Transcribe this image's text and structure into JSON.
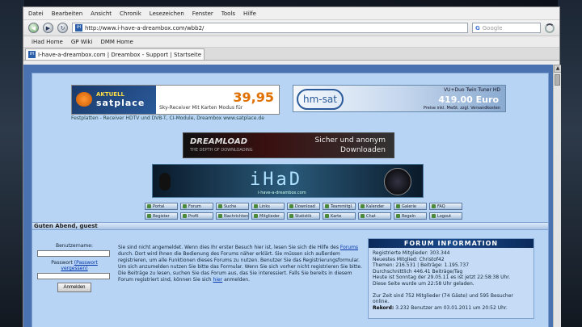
{
  "browser": {
    "menu": [
      "Datei",
      "Bearbeiten",
      "Ansicht",
      "Chronik",
      "Lesezeichen",
      "Fenster",
      "Tools",
      "Hilfe"
    ],
    "url": "http://www.i-have-a-dreambox.com/wbb2/",
    "search_placeholder": "Google",
    "bookmarks": [
      "iHad Home",
      "GP Wiki",
      "DMM Home"
    ],
    "tab_title": "I-have-a-dreambox.com | Dreambox - Support | Startseite"
  },
  "banners": {
    "satplace": {
      "aktuell": "AKTUELL",
      "name": "satplace",
      "price": "39,95",
      "slogan": "Sky-Receiver Mit Karten Modus für",
      "footer": "Festplatten - Receiver HDTV und DVB-T, CI-Module, Dreambox www.satplace.de"
    },
    "hmsat": {
      "logo": "hm-sat",
      "product": "VU+Duo Twin Tuner HD",
      "price": "419.00 Euro",
      "sub": "Preise inkl. MwSt. zzgl. Versandkosten"
    },
    "dreamload": {
      "logo": "DREAMLOAD",
      "sub": "THE DEPTH OF DOWNLOADING",
      "line1": "Sicher und anonym",
      "line2": "Downloaden"
    },
    "ihad": {
      "title": "iHaD",
      "url": "i-have-a-dreambox.com"
    }
  },
  "nav_icons": {
    "row1": [
      "Portal",
      "Forum",
      "Suche",
      "Links",
      "Download",
      "Teammitgl.",
      "Kalender",
      "Galerie",
      "FAQ"
    ],
    "row2": [
      "Register",
      "Profil",
      "Nachrichten",
      "Mitglieder",
      "Statistik",
      "Karte",
      "Chat",
      "Regeln",
      "Logout"
    ]
  },
  "greeting": "Guten Abend, guest",
  "login": {
    "username_label": "Benutzername:",
    "password_label": "Passwort",
    "password_link": "(Passwort vergessen)",
    "submit_label": "Anmelden"
  },
  "welcome": {
    "text1": "Sie sind nicht angemeldet. Wenn dies Ihr erster Besuch hier ist, lesen Sie sich die Hilfe des",
    "forum_link": "Forums",
    "text2": "durch. Dort wird Ihnen die Bedienung des Forums näher erklärt. Sie müssen sich außerdem registrieren, um alle Funktionen dieses Forums zu nutzen. Benutzer Sie das Registrierungsformular. Um sich anzumelden nutzen Sie bitte das Formular. Wenn Sie sich vorher nicht registrieren Sie bitte. Die Beiträge zu lesen, suchen Sie das Forum aus, das Sie interessiert. Falls Sie bereits in diesem Forum registriert sind, können Sie sich",
    "here_link": "hier",
    "text3": "anmelden."
  },
  "forum_info": {
    "title": "FORUM INFORMATION",
    "lines": [
      "Registrierte Mitglieder: 303.344",
      "Neuestes Mitglied: Christof42",
      "Themen: 216.531 | Beiträge: 1.195.737",
      "Durchschnittlich 446.41 Beiträge/Tag",
      "Heute ist Sonntag der 29.05.11 es ist jetzt 22:58:38 Uhr.",
      "Diese Seite wurde um 22:58 Uhr geladen.",
      "",
      "Zur Zeit sind 752 Mitglieder (74 Gäste) und 595 Besucher online."
    ],
    "record_label": "Rekord:",
    "record_text": "3.232 Benutzer am 03.01.2011 um 20:52 Uhr."
  }
}
